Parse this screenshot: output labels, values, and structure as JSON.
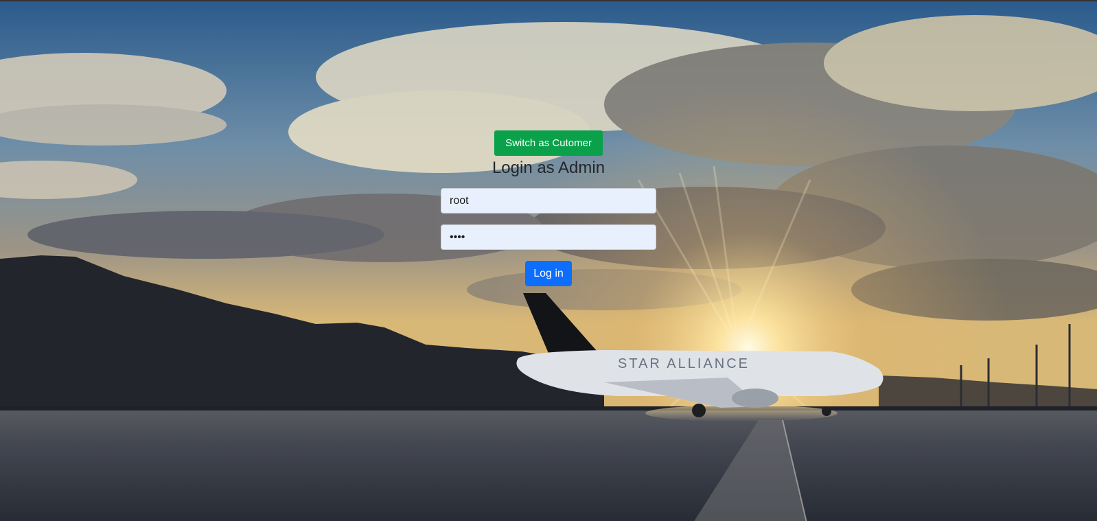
{
  "login": {
    "switch_label": "Switch as Cutomer",
    "title": "Login as Admin",
    "username_value": "root",
    "password_value": "root",
    "submit_label": "Log in"
  },
  "background": {
    "description": "airport tarmac at sunset with airliner",
    "aircraft_livery": "STAR ALLIANCE"
  },
  "colors": {
    "switch_button": "#0aa14a",
    "login_button": "#0d6efd",
    "input_background": "#e8f0fe",
    "title_text": "#24262b"
  }
}
